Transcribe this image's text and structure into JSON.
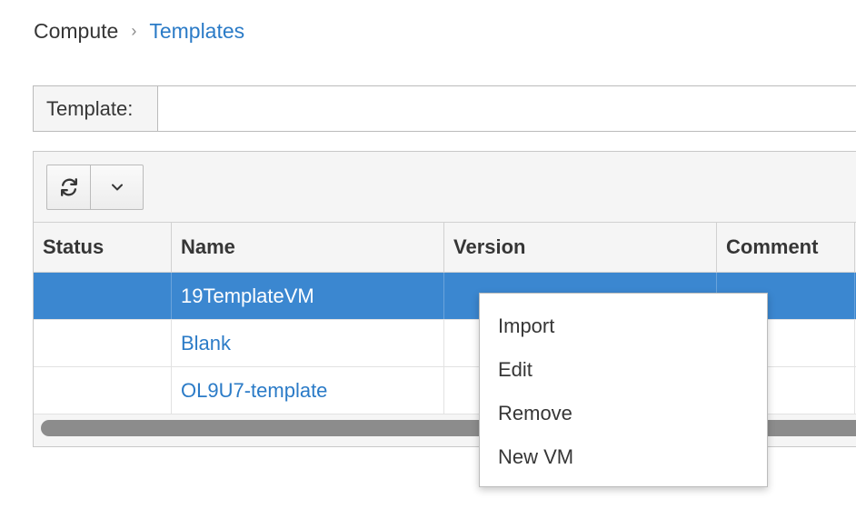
{
  "breadcrumb": {
    "root": "Compute",
    "separator": "›",
    "current": "Templates"
  },
  "search": {
    "label": "Template:",
    "value": "",
    "placeholder": ""
  },
  "toolbar": {
    "refresh_icon": "refresh-icon",
    "dropdown_icon": "chevron-down-icon"
  },
  "table": {
    "columns": [
      "Status",
      "Name",
      "Version",
      "Comment"
    ],
    "rows": [
      {
        "status": "",
        "name": "19TemplateVM",
        "version": "",
        "comment": "",
        "selected": true
      },
      {
        "status": "",
        "name": "Blank",
        "version": "",
        "comment": "",
        "selected": false
      },
      {
        "status": "",
        "name": "OL9U7-template",
        "version": "",
        "comment": "",
        "selected": false
      }
    ]
  },
  "context_menu": {
    "items": [
      "Import",
      "Edit",
      "Remove",
      "New VM"
    ]
  },
  "colors": {
    "link": "#2b7bc7",
    "selected_row": "#3b87d0"
  }
}
